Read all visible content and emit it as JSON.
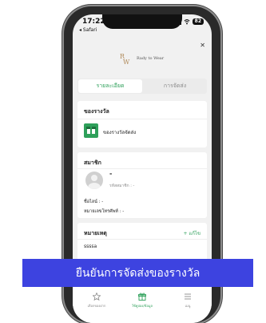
{
  "status_bar": {
    "time": "17:22",
    "back_label": "◂ Safari",
    "battery": "82"
  },
  "header": {
    "brand_mark": "RW",
    "brand_text": "Rady to Wear"
  },
  "tabs": [
    {
      "label": "รายละเอียด",
      "active": true
    },
    {
      "label": "การจัดส่ง",
      "active": false
    }
  ],
  "reward": {
    "section_title": "ของรางวัล",
    "item_name": "ของรางวัลจัดส่ง"
  },
  "member": {
    "section_title": "สมาชิก",
    "name": "-",
    "member_id_label": "รหัสสมาชิก : -",
    "nickname_label": "ชื่อไลน์ : -",
    "phone_label": "หมายเลขโทรศัพท์ : -"
  },
  "note": {
    "section_title": "หมายเหตุ",
    "add_label": "+ แก้ไข",
    "value": "ssssa"
  },
  "tabbar": [
    {
      "label": "เลือกของฝาก",
      "icon": "star-icon",
      "active": false
    },
    {
      "label": "ใช้คูปอง/ข้อมูล",
      "icon": "gift-icon",
      "active": true
    },
    {
      "label": "เมนู",
      "icon": "menu-icon",
      "active": false
    }
  ],
  "banner": {
    "text": "ยืนยันการจัดส่งของรางวัล"
  },
  "colors": {
    "accent": "#2ea05a",
    "banner": "#3d43e0"
  }
}
